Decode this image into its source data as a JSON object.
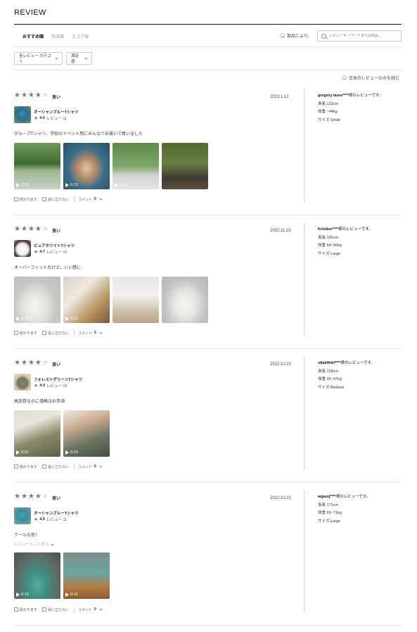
{
  "header": {
    "title": "REVIEW"
  },
  "sort": {
    "tabs": [
      "おすすめ順",
      "作成順",
      "スコア順"
    ],
    "product_filter_label": "製品により、",
    "search_placeholder": "レビューキーワードまたは商品..."
  },
  "filters": {
    "category_label": "全レビュー カテゴリ",
    "satisfaction_label": "満足度"
  },
  "jp_only_label": "日本のレビューのみを読む",
  "actions": {
    "helpful": "助かります",
    "not_helpful": "役に立たない",
    "comment": "コメント"
  },
  "reviews": [
    {
      "rating": 4,
      "rating_label": "良い",
      "date": "2023.1.12",
      "product": {
        "name": "オーシャンブルーTシャツ",
        "score": "4.5",
        "review_label": "レビュー 11",
        "thumb": "t-blue"
      },
      "text": "グループTシャツ。学校のイベント用にみんなでお揃いで買いました",
      "more_link": "",
      "media": [
        {
          "duration": "0:10",
          "style": "g-park"
        },
        {
          "duration": "0:13",
          "style": "g-boyback"
        },
        {
          "duration": "0:10",
          "style": "g-tennis"
        },
        {
          "duration": "",
          "style": "g-court"
        }
      ],
      "comment_count": "0",
      "reviewer": "gregory laure****",
      "reviewer_suffix": "様のレビューです。",
      "height": "身長 133cm",
      "weight": "体重 ~44kg",
      "size": "サイズ Small"
    },
    {
      "rating": 4,
      "rating_label": "良い",
      "date": "2022.11.23",
      "product": {
        "name": "ピュアホワイトTシャツ",
        "score": "4.7",
        "review_label": "レビュー 21",
        "thumb": "t-white"
      },
      "text": "オーバーフィットだけど、いい感じ",
      "more_link": "",
      "media": [
        {
          "duration": "0:10",
          "style": "g-gray1"
        },
        {
          "duration": "0:10",
          "style": "g-sit"
        },
        {
          "duration": "",
          "style": "g-stand"
        },
        {
          "duration": "",
          "style": "g-gray2"
        }
      ],
      "comment_count": "0",
      "reviewer": "Kristine****",
      "reviewer_suffix": "様のレビューです。",
      "height": "身長 165cm",
      "weight": "体重 54~56kg",
      "size": "サイズ Large"
    },
    {
      "rating": 4,
      "rating_label": "良い",
      "date": "2022.10.21",
      "product": {
        "name": "フォレストグリーンTシャツ",
        "score": "4.4",
        "review_label": "レビュー 10",
        "thumb": "t-green"
      },
      "text": "高品質なのに価格はお手頃",
      "more_link": "",
      "media": [
        {
          "duration": "0:21",
          "style": "g-cook"
        },
        {
          "duration": "0:23",
          "style": "g-drink"
        }
      ],
      "comment_count": "0",
      "reviewer": "sfjaklfnkl****",
      "reviewer_suffix": "様のレビューです。",
      "height": "身長 158cm",
      "weight": "体重 45~47kg",
      "size": "サイズ Medium"
    },
    {
      "rating": 4,
      "rating_label": "良い",
      "date": "2022.10.21",
      "product": {
        "name": "オーシャンブルーTシャツ",
        "score": "4.5",
        "review_label": "レビュー 11",
        "thumb": "t-green2"
      },
      "text": "クールな色！",
      "more_link": "レビューもっと見る",
      "media": [
        {
          "duration": "0:10",
          "style": "g-oldman"
        },
        {
          "duration": "0:12",
          "style": "g-room"
        }
      ],
      "comment_count": "0",
      "reviewer": "wjpeoj****",
      "reviewer_suffix": "様のレビューです。",
      "height": "身長 171cm",
      "weight": "体重 69~71kg",
      "size": "サイズ Large"
    }
  ]
}
